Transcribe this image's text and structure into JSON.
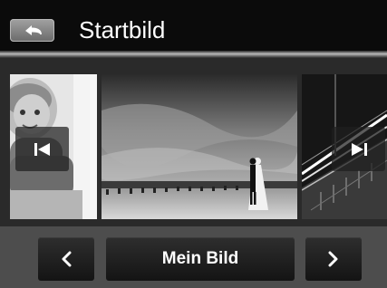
{
  "header": {
    "title": "Startbild",
    "back_icon": "back-arrow-icon"
  },
  "carousel": {
    "photos": [
      {
        "name": "photo-child",
        "position": "left"
      },
      {
        "name": "photo-wedding-beach",
        "position": "center",
        "selected": true
      },
      {
        "name": "photo-night-road",
        "position": "right"
      }
    ],
    "prev_icon": "skip-previous-icon",
    "next_icon": "skip-next-icon"
  },
  "footer": {
    "prev_icon": "chevron-left-icon",
    "option_label": "Mein Bild",
    "next_icon": "chevron-right-icon"
  },
  "colors": {
    "header_bg": "#0b0b0b",
    "body_bg": "#4d4d4d",
    "button_bg": "#1e1e1e",
    "text": "#ffffff"
  }
}
